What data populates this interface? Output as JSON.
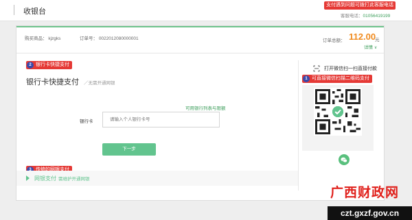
{
  "header": {
    "title": "收银台",
    "help_banner": "支付遇到问题可拨打此客服电话",
    "phone_label": "客服电话：",
    "phone_number": "01056419199"
  },
  "order": {
    "goods_label": "购买商品：",
    "goods_value": "kjzgks",
    "order_no_label": "订单号：",
    "order_no_value": "0022012080000001",
    "total_label": "订单总额：",
    "amount": "112.00",
    "currency": "元",
    "detail_link": "详情"
  },
  "annotations": {
    "bank_quick": {
      "num": "2",
      "text": "银行卡快捷支付"
    },
    "wechat": {
      "num": "1",
      "text": "可直接微信扫描二维码支付"
    },
    "netbank": {
      "num": "3",
      "text": "传统的网银支付"
    }
  },
  "bank_pay": {
    "title": "银行卡快捷支付",
    "subtitle": "／无需开通网银",
    "bank_list_link": "可用银行列表与限额",
    "card_label": "银行卡",
    "card_placeholder": "请输入个人银行卡号",
    "next_button": "下一步"
  },
  "netbank": {
    "label": "网银支付",
    "sub": "需维护开通网银"
  },
  "wechat": {
    "scan_text": "打开微信扫一扫直接付款"
  },
  "footer": {
    "logo": "广西财政网",
    "domain": "czt.gxzf.gov.cn"
  },
  "colors": {
    "accent_green": "#62c48e",
    "amount_orange": "#f08a1d",
    "annotation_red": "#e53935",
    "badge_blue": "#3949ab"
  },
  "icons": {
    "scan": "scan-icon",
    "qr": "qr-code-icon",
    "wechat": "wechat-icon",
    "expand": "chevron-down-icon",
    "netbank": "triangle-right-icon"
  }
}
